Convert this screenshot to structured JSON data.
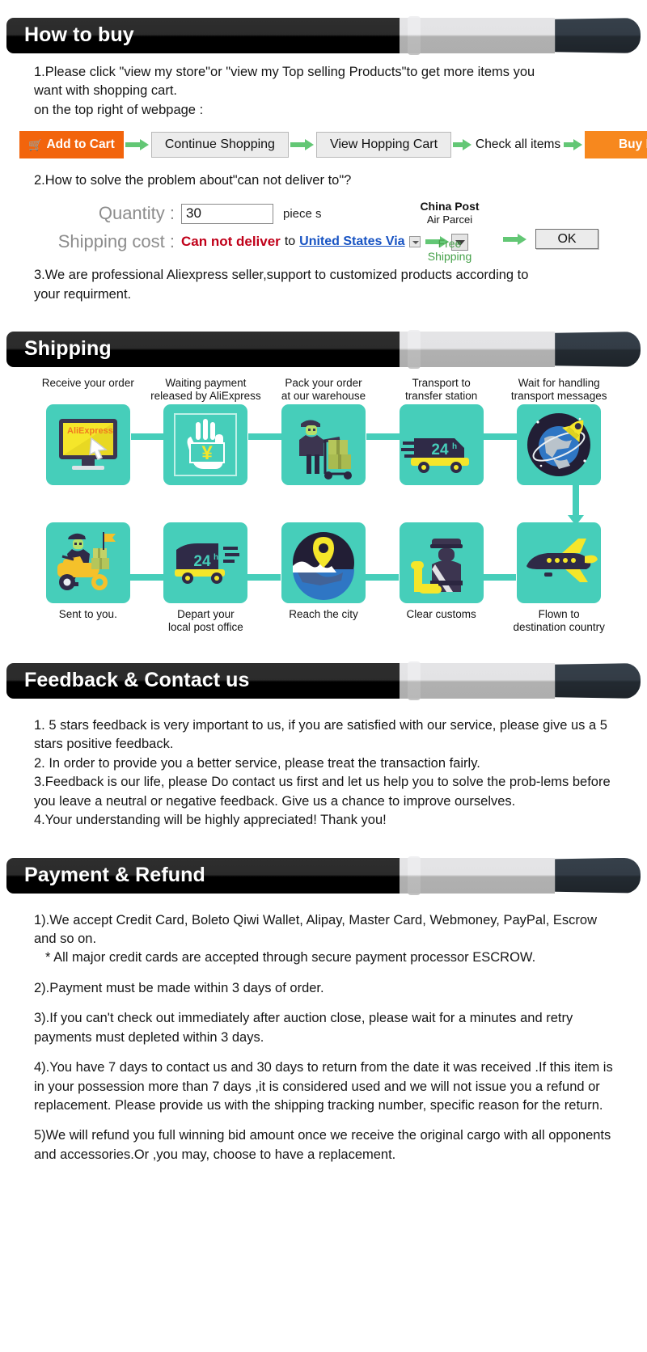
{
  "sections": {
    "how_to_buy": {
      "title": "How to buy",
      "step1_line1": "1.Please click \"view my store\"or \"view my Top selling Products\"to get more items you",
      "step1_line2": "want with shopping cart.",
      "step1_line3": "on the top right of webpage :",
      "flow": {
        "add_to_cart": "Add to Cart",
        "cart_icon": "shopping-cart-icon",
        "continue_shopping": "Continue Shopping",
        "view_hopping_cart": "View Hopping Cart",
        "check_all_items": "Check all items",
        "buy_now": "Buy Now"
      },
      "step2": "2.How to solve the problem about\"can not deliver to\"?",
      "form": {
        "quantity_label": "Quantity :",
        "quantity_value": "30",
        "quantity_unit": "piece s",
        "shipping_label": "Shipping cost :",
        "cannot_deliver": "Can not deliver",
        "to": "to",
        "country_link": "United States Via",
        "carrier_name": "China Post",
        "carrier_sub": "Air Parcei",
        "price": "Free",
        "price_sub": "Shipping",
        "ok_button": "OK"
      },
      "step3_line1": "3.We are professional Aliexpress seller,support to customized products according to",
      "step3_line2": "your requirment."
    },
    "shipping": {
      "title": "Shipping",
      "steps_top": [
        {
          "caption": "Receive your order",
          "icon": "monitor-aliexpress-icon"
        },
        {
          "caption": "Waiting payment\nreleased by AliExpress",
          "icon": "hand-yen-icon"
        },
        {
          "caption": "Pack your order\nat our warehouse",
          "icon": "worker-boxes-icon"
        },
        {
          "caption": "Transport to\ntransfer station",
          "icon": "truck-24h-icon"
        },
        {
          "caption": "Wait for handling\ntransport messages",
          "icon": "globe-rocket-icon"
        }
      ],
      "steps_bottom": [
        {
          "caption": "Sent to you.",
          "icon": "scooter-courier-icon"
        },
        {
          "caption": "Depart your\nlocal post office",
          "icon": "van-24h-icon"
        },
        {
          "caption": "Reach the city",
          "icon": "map-pin-globe-icon"
        },
        {
          "caption": "Clear customs",
          "icon": "customs-officer-icon"
        },
        {
          "caption": "Flown to\ndestination country",
          "icon": "airplane-icon"
        }
      ]
    },
    "feedback": {
      "title": "Feedback & Contact us",
      "lines": [
        "1. 5 stars feedback is very important to us, if you are satisfied with our service, please give us a 5 stars positive feedback.",
        "2. In order to provide you a better service, please treat the transaction fairly.",
        "3.Feedback is our life, please Do contact us first and let us help you to solve the prob-lems before you leave a neutral or negative feedback. Give us a chance to improve ourselves.",
        "4.Your understanding will be highly appreciated! Thank you!"
      ]
    },
    "payment": {
      "title": "Payment & Refund",
      "p1": "1).We accept Credit Card, Boleto Qiwi Wallet, Alipay, Master Card, Webmoney, PayPal, Escrow and so on.",
      "p1b": "* All major credit cards are accepted through secure payment processor ESCROW.",
      "p2": "2).Payment must be made within 3 days of order.",
      "p3": "3).If you can't check out immediately after auction close, please wait for a minutes and retry payments must depleted within 3 days.",
      "p4": "4).You have 7 days to contact us and 30 days to return from the date it was received .If this item is in your possession more than 7 days ,it is considered used and we will not issue you a refund or replacement. Please provide us with the shipping tracking number, specific reason for the return.",
      "p5": "5)We will refund you full winning bid amount once we receive the original cargo with all opponents and accessories.Or ,you may, choose to have a replacement."
    }
  },
  "colors": {
    "banner_dark": "#000000",
    "banner_light": "#e4e4e6",
    "banner_cap": "#2b333b",
    "orange_primary": "#f2640c",
    "orange_secondary": "#f7881e",
    "green_arrow": "#63c775",
    "teal_tile": "#46ceba",
    "link_blue": "#1753c3",
    "alert_red": "#c00019",
    "free_green": "#46a14a",
    "yellow": "#f5e62a",
    "navy": "#2f2a47"
  }
}
